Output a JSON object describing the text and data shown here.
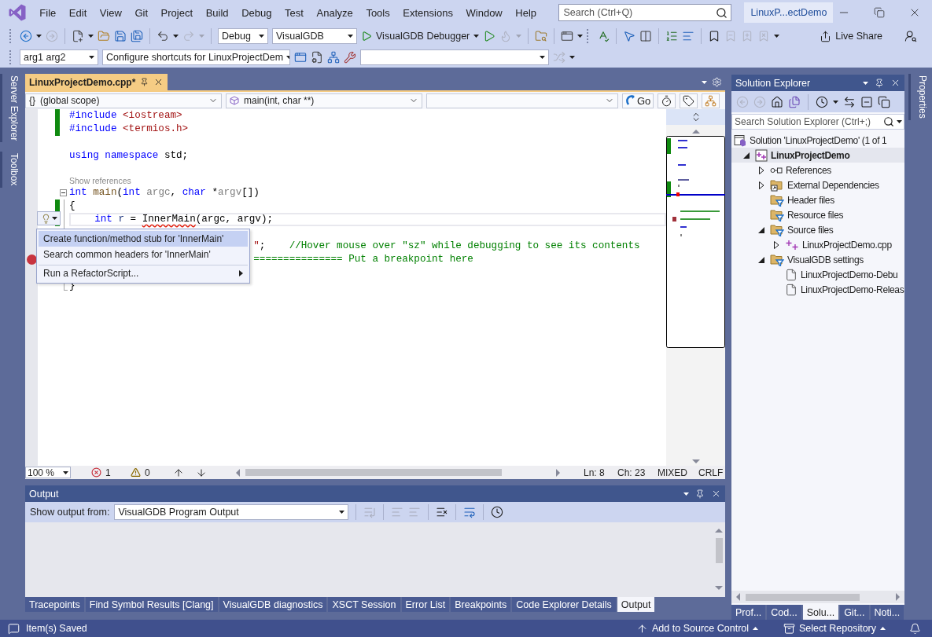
{
  "window": {
    "title": "LinuxP...ectDemo"
  },
  "menu": [
    "File",
    "Edit",
    "View",
    "Git",
    "Project",
    "Build",
    "Debug",
    "Test",
    "Analyze",
    "Tools",
    "Extensions",
    "Window",
    "Help"
  ],
  "search": {
    "placeholder": "Search (Ctrl+Q)"
  },
  "toolbar": {
    "configuration": "Debug",
    "platform": "VisualGDB",
    "debugger": "VisualGDB Debugger",
    "live_share": "Live Share"
  },
  "toolbar2": {
    "arguments": "arg1 arg2",
    "shortcuts": "Configure shortcuts for LinuxProjectDem"
  },
  "left_tabs": [
    "Server Explorer",
    "Toolbox"
  ],
  "editor": {
    "tabs": [
      {
        "label": "LinuxProjectDemo.cpp*",
        "selected": true
      }
    ],
    "scope": {
      "glyph": "{}",
      "label": "(global scope)"
    },
    "member": "main(int, char **)",
    "go": "Go",
    "lines": [
      {
        "kind": "code",
        "changed": true,
        "current": false,
        "breakpoint": false,
        "collapsible": false,
        "covered": false,
        "tokens": [
          {
            "text": "#include",
            "kind": "keyword"
          },
          {
            "text": " <iostream>",
            "kind": "string"
          }
        ]
      },
      {
        "kind": "code",
        "changed": true,
        "current": false,
        "breakpoint": false,
        "collapsible": false,
        "covered": false,
        "tokens": [
          {
            "text": "#include",
            "kind": "keyword"
          },
          {
            "text": " <termios.h>",
            "kind": "string"
          }
        ]
      },
      {
        "kind": "blank",
        "changed": false,
        "current": false,
        "breakpoint": false
      },
      {
        "kind": "code",
        "changed": false,
        "current": false,
        "breakpoint": false,
        "collapsible": false,
        "covered": false,
        "tokens": [
          {
            "text": "using namespace",
            "kind": "keyword"
          },
          {
            "text": " std;",
            "kind": "plain"
          }
        ]
      },
      {
        "kind": "blank",
        "changed": false,
        "current": false,
        "breakpoint": false
      },
      {
        "kind": "lens",
        "text": "Show references"
      },
      {
        "kind": "code",
        "changed": false,
        "current": false,
        "breakpoint": false,
        "collapsible": true,
        "covered": false,
        "tokens": [
          {
            "text": "int ",
            "kind": "keyword"
          },
          {
            "text": "main",
            "kind": "function"
          },
          {
            "text": "(",
            "kind": "plain"
          },
          {
            "text": "int ",
            "kind": "keyword"
          },
          {
            "text": "argc",
            "kind": "parameter"
          },
          {
            "text": ", ",
            "kind": "plain"
          },
          {
            "text": "char ",
            "kind": "keyword"
          },
          {
            "text": "*",
            "kind": "plain"
          },
          {
            "text": "argv",
            "kind": "parameter"
          },
          {
            "text": "[])",
            "kind": "plain"
          }
        ]
      },
      {
        "kind": "code",
        "changed": true,
        "current": false,
        "breakpoint": false,
        "collapsible": false,
        "covered": false,
        "tokens": [
          {
            "text": "{",
            "kind": "plain"
          }
        ]
      },
      {
        "kind": "code",
        "changed": true,
        "current": true,
        "breakpoint": false,
        "collapsible": false,
        "covered": false,
        "tokens": [
          {
            "text": "    int ",
            "kind": "keyword"
          },
          {
            "text": "r",
            "kind": "variable"
          },
          {
            "text": " = ",
            "kind": "plain"
          },
          {
            "text": "InnerMain",
            "kind": "error"
          },
          {
            "text": "(argc, argv);",
            "kind": "plain"
          }
        ]
      },
      {
        "kind": "hidden"
      },
      {
        "kind": "code",
        "current": false,
        "breakpoint": false,
        "collapsible": false,
        "covered": true,
        "tokens": [
          {
            "text": "\"",
            "kind": "string"
          },
          {
            "text": ";",
            "kind": "plain"
          },
          {
            "text": "    //Hover mouse over \"sz\" while debugging to see its contents",
            "kind": "comment"
          }
        ]
      },
      {
        "kind": "code",
        "current": false,
        "breakpoint": true,
        "collapsible": false,
        "covered": true,
        "tokens": [
          {
            "text": "=============== Put a breakpoint here",
            "kind": "comment"
          }
        ]
      },
      {
        "kind": "hidden"
      },
      {
        "kind": "code",
        "changed": false,
        "current": false,
        "breakpoint": false,
        "collapsible": false,
        "covered": false,
        "tokens": [
          {
            "text": "}",
            "kind": "plain"
          }
        ]
      }
    ],
    "lightbulb_menu": [
      {
        "label": "Create function/method stub for 'InnerMain'",
        "selected": true,
        "submenu": false,
        "divider_before": false
      },
      {
        "label": "Search common headers for 'InnerMain'",
        "selected": false,
        "submenu": false,
        "divider_before": false
      },
      {
        "label": "Run a RefactorScript...",
        "selected": false,
        "submenu": true,
        "divider_before": true
      }
    ],
    "status": {
      "zoom": "100 %",
      "errors": "1",
      "warnings": "0",
      "line": "Ln: 8",
      "column": "Ch: 23",
      "whitespace": "MIXED",
      "line_endings": "CRLF"
    }
  },
  "output": {
    "title": "Output",
    "source_label": "Show output from:",
    "source": "VisualGDB Program Output"
  },
  "bottom_tabs": [
    {
      "label": "Tracepoints",
      "selected": false
    },
    {
      "label": "Find Symbol Results [Clang]",
      "selected": false
    },
    {
      "label": "VisualGDB diagnostics",
      "selected": false
    },
    {
      "label": "XSCT Session",
      "selected": false
    },
    {
      "label": "Error List",
      "selected": false
    },
    {
      "label": "Breakpoints",
      "selected": false
    },
    {
      "label": "Code Explorer Details",
      "selected": false
    },
    {
      "label": "Output",
      "selected": true
    }
  ],
  "solution_explorer": {
    "title": "Solution Explorer",
    "search": {
      "placeholder": "Search Solution Explorer (Ctrl+;)"
    },
    "tree": [
      {
        "label": "Solution 'LinuxProjectDemo' (1 of 1",
        "kind": "solution",
        "selected": false,
        "children": [
          {
            "label": "LinuxProjectDemo",
            "kind": "project",
            "selected": true,
            "expanded": true,
            "children": [
              {
                "label": "References",
                "kind": "references",
                "selected": false,
                "expanded": false
              },
              {
                "label": "External Dependencies",
                "kind": "dependencies",
                "selected": false,
                "expanded": false
              },
              {
                "label": "Header files",
                "kind": "filter",
                "selected": false
              },
              {
                "label": "Resource files",
                "kind": "filter",
                "selected": false
              },
              {
                "label": "Source files",
                "kind": "filter",
                "selected": false,
                "expanded": true,
                "children": [
                  {
                    "label": "LinuxProjectDemo.cpp",
                    "kind": "source",
                    "selected": false,
                    "expanded": false
                  }
                ]
              },
              {
                "label": "VisualGDB settings",
                "kind": "filter",
                "selected": false,
                "expanded": true,
                "children": [
                  {
                    "label": "LinuxProjectDemo-Debu",
                    "kind": "document",
                    "selected": false
                  },
                  {
                    "label": "LinuxProjectDemo-Releas",
                    "kind": "document",
                    "selected": false
                  }
                ]
              }
            ]
          }
        ]
      }
    ],
    "tabs": [
      {
        "label": "Prof...",
        "selected": false
      },
      {
        "label": "Cod...",
        "selected": false
      },
      {
        "label": "Solu...",
        "selected": true
      },
      {
        "label": "Git...",
        "selected": false
      },
      {
        "label": "Noti...",
        "selected": false
      }
    ]
  },
  "right_tabs": [
    "Properties"
  ],
  "status_bar": {
    "message": "Item(s) Saved",
    "source_control": "Add to Source Control",
    "repository": "Select Repository"
  }
}
